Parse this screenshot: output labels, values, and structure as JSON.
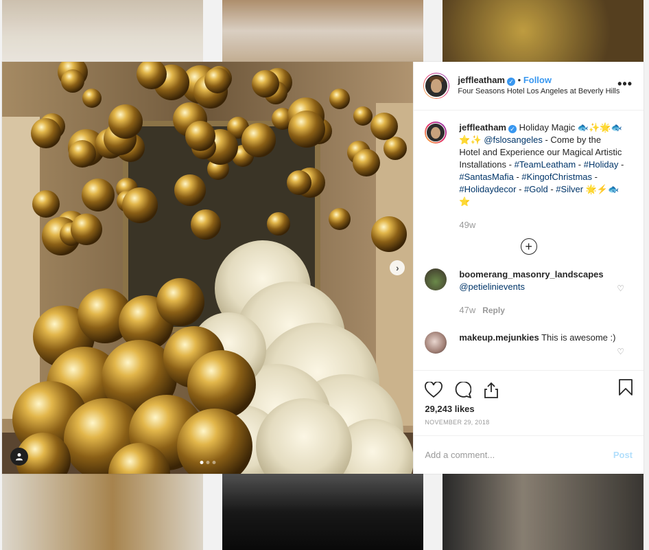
{
  "post": {
    "username": "jeffleatham",
    "follow_separator": "•",
    "follow_label": "Follow",
    "location": "Four Seasons Hotel Los Angeles at Beverly Hills",
    "more_label": "•••"
  },
  "caption": {
    "username": "jeffleatham",
    "segments": [
      {
        "text": "Holiday Magic 🐟✨🌟🐟⭐✨ ",
        "type": "text"
      },
      {
        "text": "@fslosangeles",
        "type": "link"
      },
      {
        "text": " - Come by the Hotel and Experience our Magical Artistic Installations - ",
        "type": "text"
      },
      {
        "text": "#TeamLeatham",
        "type": "link"
      },
      {
        "text": " - ",
        "type": "text"
      },
      {
        "text": "#Holiday",
        "type": "link"
      },
      {
        "text": " - ",
        "type": "text"
      },
      {
        "text": "#SantasMafia",
        "type": "link"
      },
      {
        "text": " - ",
        "type": "text"
      },
      {
        "text": "#KingofChristmas",
        "type": "link"
      },
      {
        "text": " - ",
        "type": "text"
      },
      {
        "text": "#Holidaydecor",
        "type": "link"
      },
      {
        "text": " - ",
        "type": "text"
      },
      {
        "text": "#Gold",
        "type": "link"
      },
      {
        "text": " - ",
        "type": "text"
      },
      {
        "text": "#Silver",
        "type": "link"
      },
      {
        "text": " 🌟⚡🐟⭐",
        "type": "text"
      }
    ],
    "age": "49w"
  },
  "load_more_label": "+",
  "comments": [
    {
      "username": "boomerang_masonry_landscapes",
      "mention": "@petielinievents",
      "text": "",
      "age": "47w",
      "reply_label": "Reply"
    },
    {
      "username": "makeup.mejunkies",
      "mention": "",
      "text": "This is awesome :)",
      "age": "",
      "reply_label": ""
    }
  ],
  "likes_text": "29,243 likes",
  "date_text": "NOVEMBER 29, 2018",
  "add_comment_placeholder": "Add a comment...",
  "post_label": "Post",
  "carousel": {
    "slide_count": 3,
    "active_index": 0
  },
  "colors": {
    "link": "#003569",
    "accent": "#3897f0",
    "muted": "#999999",
    "post_disabled": "#b2dffc"
  }
}
